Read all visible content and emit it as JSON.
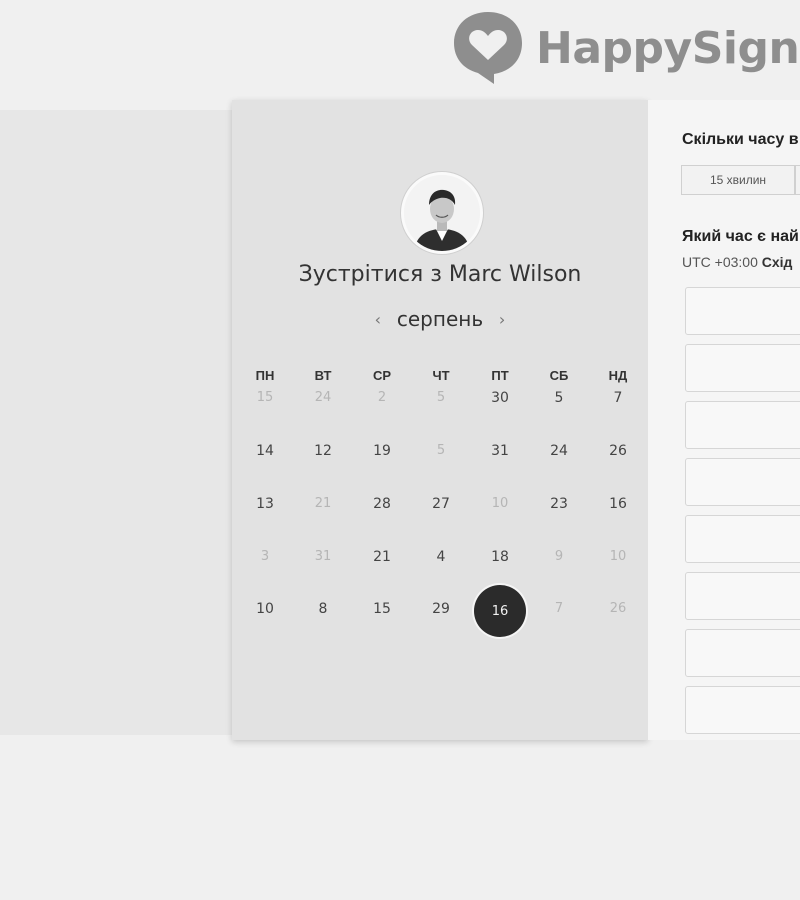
{
  "logo": {
    "text": "HappySigna",
    "icon": "heart-speech-bubble-icon",
    "color": "#8e8e8e"
  },
  "calendar": {
    "title": "Зустрітися з Marc Wilson",
    "month": "серпень",
    "prev_icon": "‹",
    "next_icon": "›",
    "weekdays": [
      "ПН",
      "ВТ",
      "СР",
      "ЧТ",
      "ПТ",
      "СБ",
      "НД"
    ],
    "weeks": [
      [
        {
          "d": "15",
          "enabled": false
        },
        {
          "d": "24",
          "enabled": false
        },
        {
          "d": "2",
          "enabled": false
        },
        {
          "d": "5",
          "enabled": false
        },
        {
          "d": "30",
          "enabled": true
        },
        {
          "d": "5",
          "enabled": true
        },
        {
          "d": "7",
          "enabled": true
        }
      ],
      [
        {
          "d": "14",
          "enabled": true
        },
        {
          "d": "12",
          "enabled": true
        },
        {
          "d": "19",
          "enabled": true
        },
        {
          "d": "5",
          "enabled": false
        },
        {
          "d": "31",
          "enabled": true
        },
        {
          "d": "24",
          "enabled": true
        },
        {
          "d": "26",
          "enabled": true
        }
      ],
      [
        {
          "d": "13",
          "enabled": true
        },
        {
          "d": "21",
          "enabled": false
        },
        {
          "d": "28",
          "enabled": true
        },
        {
          "d": "27",
          "enabled": true
        },
        {
          "d": "10",
          "enabled": false
        },
        {
          "d": "23",
          "enabled": true
        },
        {
          "d": "16",
          "enabled": true
        }
      ],
      [
        {
          "d": "3",
          "enabled": false
        },
        {
          "d": "31",
          "enabled": false
        },
        {
          "d": "21",
          "enabled": true
        },
        {
          "d": "4",
          "enabled": true
        },
        {
          "d": "18",
          "enabled": true
        },
        {
          "d": "9",
          "enabled": false
        },
        {
          "d": "10",
          "enabled": false
        }
      ],
      [
        {
          "d": "10",
          "enabled": true
        },
        {
          "d": "8",
          "enabled": true
        },
        {
          "d": "15",
          "enabled": true
        },
        {
          "d": "29",
          "enabled": true
        },
        {
          "d": "16",
          "enabled": true,
          "selected": true
        },
        {
          "d": "7",
          "enabled": false
        },
        {
          "d": "26",
          "enabled": false
        }
      ]
    ],
    "selected_color": "#2b2b2b"
  },
  "booking": {
    "duration_question": "Скільки часу в",
    "durations": [
      "15 хвилин",
      ""
    ],
    "time_question": "Який час є най",
    "timezone_code": "UTC +03:00",
    "timezone_name": "Схід",
    "slot_count": 8
  }
}
